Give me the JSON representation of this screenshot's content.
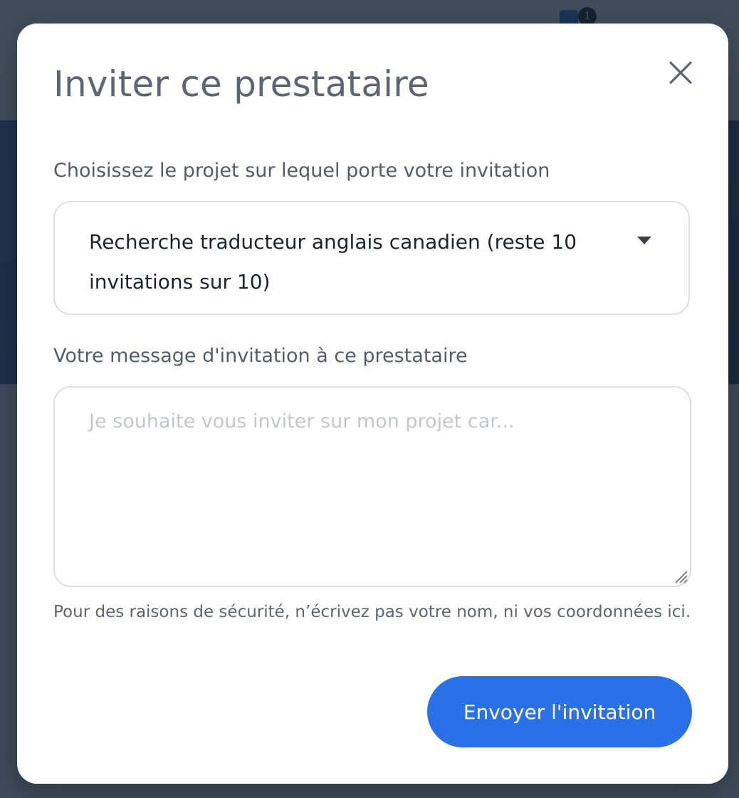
{
  "background": {
    "notification_count": "1"
  },
  "modal": {
    "title": "Inviter ce prestataire",
    "close_icon": "close-icon",
    "project": {
      "label": "Choisissez le projet sur lequel porte votre invitation",
      "selected_value": "Recherche traducteur anglais canadien (reste 10 invitations sur 10)"
    },
    "message": {
      "label": "Votre message d'invitation à ce prestataire",
      "placeholder": "Je souhaite vous inviter sur mon projet car...",
      "value": ""
    },
    "security_note": "Pour des raisons de sécurité, n’écrivez pas votre nom, ni vos coordonnées ici.",
    "send_label": "Envoyer l'invitation"
  },
  "colors": {
    "accent": "#2a70e6",
    "title": "#5d6670",
    "border": "#dcdfe3",
    "overlay": "#192638"
  }
}
